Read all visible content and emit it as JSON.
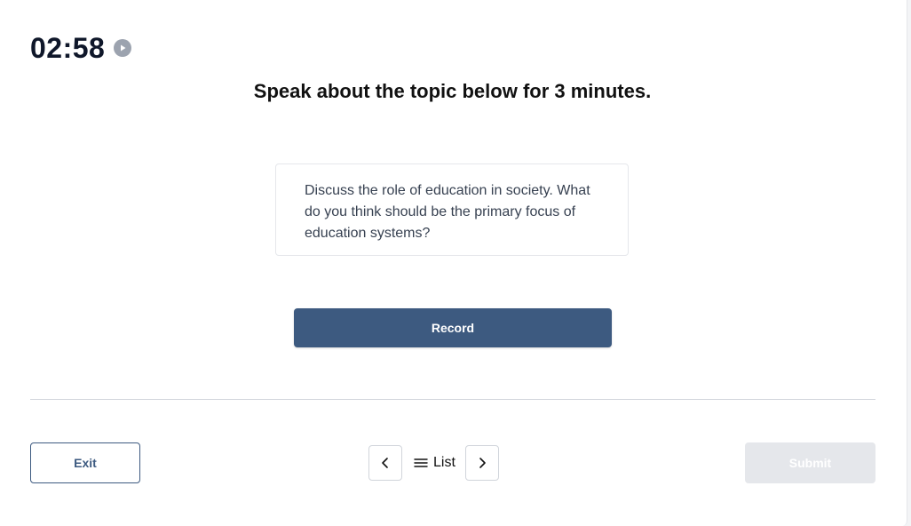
{
  "timer": {
    "value": "02:58",
    "play_icon": "play-icon"
  },
  "instruction": "Speak about the topic below for 3 minutes.",
  "prompt": {
    "text": "Discuss the role of education in society. What do you think should be the primary focus of education systems?"
  },
  "record_button": {
    "label": "Record"
  },
  "footer": {
    "exit_label": "Exit",
    "prev_icon": "chevron-left-icon",
    "list_icon": "menu-icon",
    "list_label": "List",
    "next_icon": "chevron-right-icon",
    "submit_label": "Submit",
    "submit_disabled": true
  },
  "colors": {
    "primary": "#3d5a80",
    "disabled": "#e5e7eb",
    "text_dark": "#0f172a",
    "border": "#d1d5db"
  }
}
